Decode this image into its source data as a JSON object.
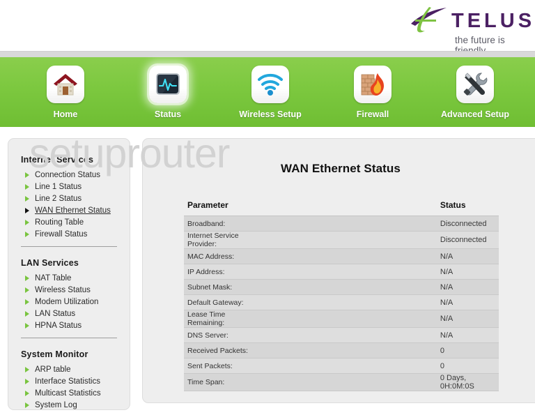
{
  "brand": {
    "name": "TELUS",
    "tagline": "the future is friendly",
    "purple": "#4b2063",
    "green": "#79c43f"
  },
  "watermark": "setuprouter",
  "nav": {
    "items": [
      {
        "label": "Home",
        "icon": "home-icon",
        "active": false
      },
      {
        "label": "Status",
        "icon": "status-monitor-icon",
        "active": true
      },
      {
        "label": "Wireless Setup",
        "icon": "wifi-icon",
        "active": false
      },
      {
        "label": "Firewall",
        "icon": "firewall-flame-icon",
        "active": false
      },
      {
        "label": "Advanced Setup",
        "icon": "tools-icon",
        "active": false
      }
    ]
  },
  "sidebar": {
    "groups": [
      {
        "title": "Internet Services",
        "items": [
          {
            "label": "Connection Status",
            "active": false
          },
          {
            "label": "Line 1 Status",
            "active": false
          },
          {
            "label": "Line 2 Status",
            "active": false
          },
          {
            "label": "WAN Ethernet Status",
            "active": true
          },
          {
            "label": "Routing Table",
            "active": false
          },
          {
            "label": "Firewall Status",
            "active": false
          }
        ]
      },
      {
        "title": "LAN Services",
        "items": [
          {
            "label": "NAT Table",
            "active": false
          },
          {
            "label": "Wireless Status",
            "active": false
          },
          {
            "label": "Modem Utilization",
            "active": false
          },
          {
            "label": "LAN Status",
            "active": false
          },
          {
            "label": "HPNA Status",
            "active": false
          }
        ]
      },
      {
        "title": "System Monitor",
        "items": [
          {
            "label": "ARP table",
            "active": false
          },
          {
            "label": "Interface Statistics",
            "active": false
          },
          {
            "label": "Multicast Statistics",
            "active": false
          },
          {
            "label": "System Log",
            "active": false
          }
        ]
      }
    ]
  },
  "main": {
    "title": "WAN Ethernet Status",
    "table": {
      "headers": [
        "Parameter",
        "Status"
      ],
      "rows": [
        {
          "parameter": "Broadband:",
          "status": "Disconnected",
          "state": "bad"
        },
        {
          "parameter": "Internet Service Provider:",
          "status": "Disconnected",
          "state": "bad"
        },
        {
          "parameter": "MAC Address:",
          "status": "N/A",
          "state": "none"
        },
        {
          "parameter": "IP Address:",
          "status": "N/A",
          "state": "none"
        },
        {
          "parameter": "Subnet Mask:",
          "status": "N/A",
          "state": "none"
        },
        {
          "parameter": "Default Gateway:",
          "status": "N/A",
          "state": "none"
        },
        {
          "parameter": "Lease Time Remaining:",
          "status": "N/A",
          "state": "none"
        },
        {
          "parameter": "DNS Server:",
          "status": "N/A",
          "state": "none"
        },
        {
          "parameter": "Received Packets:",
          "status": "0",
          "state": "none"
        },
        {
          "parameter": "Sent Packets:",
          "status": "0",
          "state": "none"
        },
        {
          "parameter": "Time Span:",
          "status": "0 Days, 0H:0M:0S",
          "state": "none"
        }
      ]
    }
  }
}
